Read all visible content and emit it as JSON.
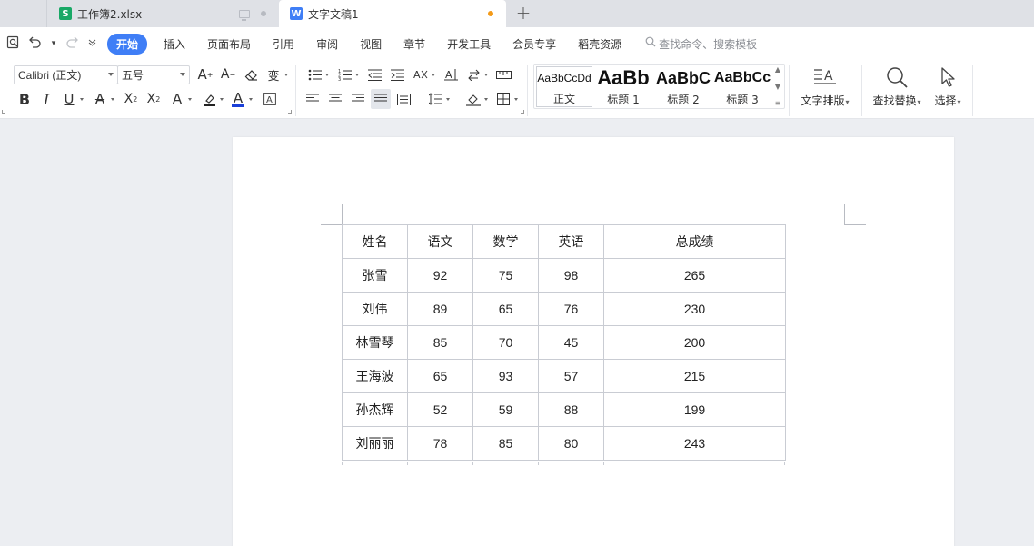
{
  "tabs": [
    {
      "title": "工作簿2.xlsx",
      "badge": "S",
      "badge_color": "#19a866",
      "active": false
    },
    {
      "title": "文字文稿1",
      "badge": "W",
      "badge_color": "#3f7ef6",
      "active": true,
      "unsaved_dot_color": "#f39a18"
    }
  ],
  "menu": {
    "items": [
      "开始",
      "插入",
      "页面布局",
      "引用",
      "审阅",
      "视图",
      "章节",
      "开发工具",
      "会员专享",
      "稻壳资源"
    ],
    "active": "开始",
    "search_placeholder": "查找命令、搜索模板"
  },
  "toolbar": {
    "font_name": "Calibri (正文)",
    "font_size": "五号",
    "styles": [
      {
        "preview": "AaBbCcDd",
        "name": "正文"
      },
      {
        "preview": "AaBb",
        "name": "标题 1"
      },
      {
        "preview": "AaBbC",
        "name": "标题 2"
      },
      {
        "preview": "AaBbCc",
        "name": "标题 3"
      }
    ],
    "text_layout_label": "文字排版",
    "find_replace_label": "查找替换",
    "select_label": "选择"
  },
  "document": {
    "table": {
      "headers": [
        "姓名",
        "语文",
        "数学",
        "英语",
        "总成绩"
      ],
      "rows": [
        [
          "张雪",
          "92",
          "75",
          "98",
          "265"
        ],
        [
          "刘伟",
          "89",
          "65",
          "76",
          "230"
        ],
        [
          "林雪琴",
          "85",
          "70",
          "45",
          "200"
        ],
        [
          "王海波",
          "65",
          "93",
          "57",
          "215"
        ],
        [
          "孙杰辉",
          "52",
          "59",
          "88",
          "199"
        ],
        [
          "刘丽丽",
          "78",
          "85",
          "80",
          "243"
        ]
      ]
    }
  },
  "colors": {
    "accent": "#3f7ef6",
    "highlight": "#f5c518",
    "font_color": "#1a3fd8"
  }
}
